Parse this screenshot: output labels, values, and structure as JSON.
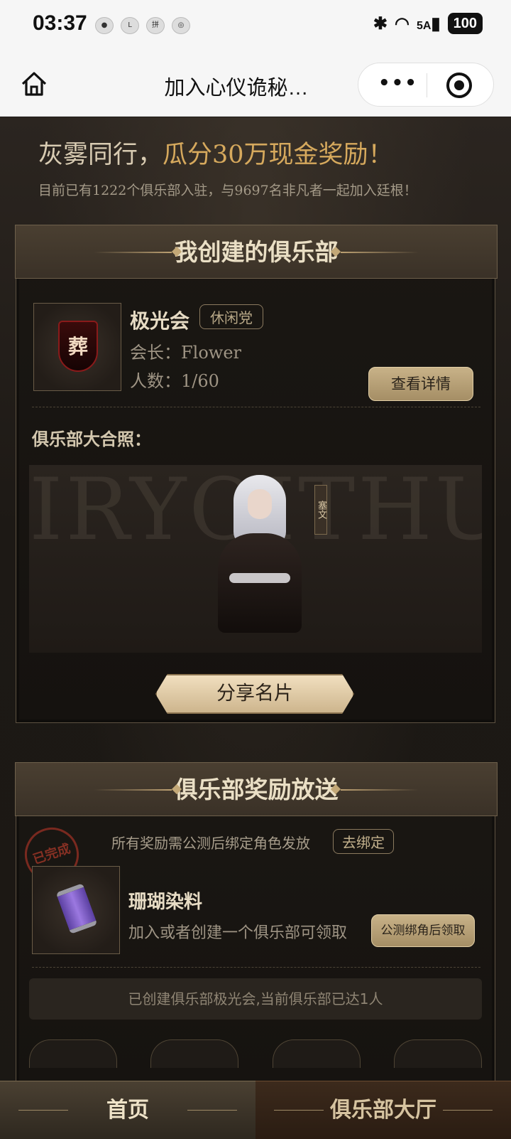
{
  "status_bar": {
    "time": "03:37",
    "notif_icons": [
      "ghost-icon",
      "lulu-icon",
      "pin-icon",
      "compass-icon"
    ],
    "network": "5A",
    "battery": "100"
  },
  "nav": {
    "title": "加入心仪诡秘…",
    "more": "•••"
  },
  "hero": {
    "title_main": "灰雾同行，",
    "title_highlight": "瓜分30万现金奖励！",
    "subtitle": "目前已有1222个俱乐部入驻，与9697名非凡者一起加入廷根！"
  },
  "my_club": {
    "section_title": "我创建的俱乐部",
    "emblem_char": "葬",
    "name": "极光会",
    "tag": "休闲党",
    "leader": "会长：Flower",
    "members": "人数：1/60",
    "detail_button": "查看详情",
    "photo_label": "俱乐部大合照：",
    "photo_bg_text": "IRYOITHU",
    "character_tag": "塞文",
    "share_button": "分享名片"
  },
  "rewards": {
    "section_title": "俱乐部奖励放送",
    "stamp_text": "已完成",
    "note": "所有奖励需公测后绑定角色发放",
    "bind_button": "去绑定",
    "item_name": "珊瑚染料",
    "item_desc": "加入或者创建一个俱乐部可领取",
    "claim_button": "公测绑角后领取",
    "status": "已创建俱乐部极光会,当前俱乐部已达1人"
  },
  "tabs": {
    "home": "首页",
    "hall": "俱乐部大厅"
  },
  "colors": {
    "accent_gold": "#d6a95d",
    "button_gold": "#c8b288",
    "background": "#1e1a16"
  }
}
